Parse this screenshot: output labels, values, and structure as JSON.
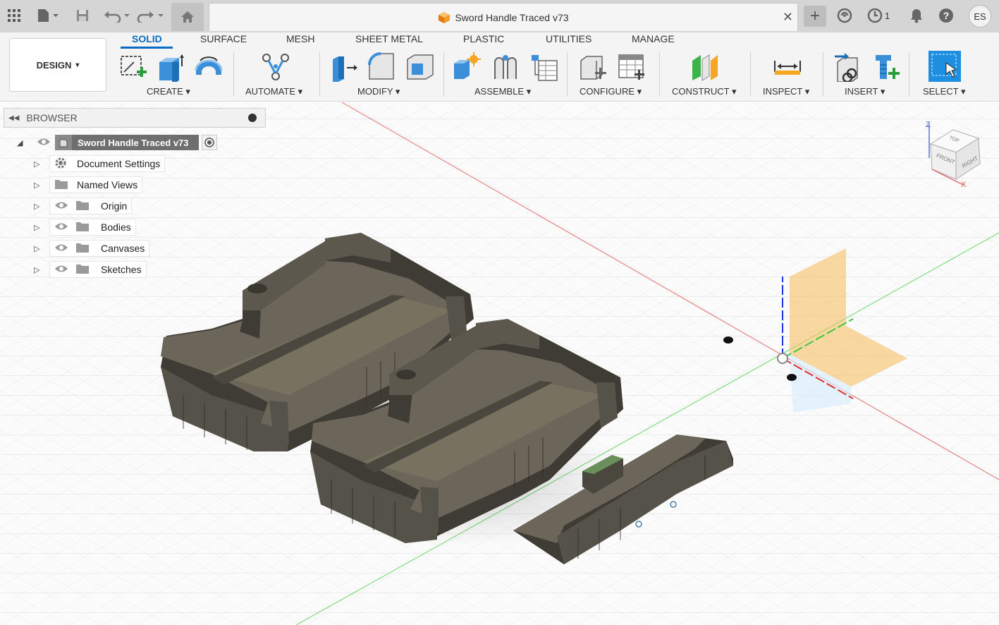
{
  "window": {
    "document_title": "Sword Handle Traced v73",
    "job_count": "1",
    "user_initials": "ES",
    "close_glyph": "✕",
    "plus_glyph": "+"
  },
  "workspace": {
    "label": "DESIGN",
    "caret": "▾"
  },
  "tabs": [
    {
      "label": "SOLID",
      "active": true
    },
    {
      "label": "SURFACE"
    },
    {
      "label": "MESH"
    },
    {
      "label": "SHEET METAL"
    },
    {
      "label": "PLASTIC"
    },
    {
      "label": "UTILITIES"
    },
    {
      "label": "MANAGE"
    }
  ],
  "groups": [
    {
      "label": "CREATE ▾"
    },
    {
      "label": "AUTOMATE ▾"
    },
    {
      "label": "MODIFY ▾"
    },
    {
      "label": "ASSEMBLE ▾"
    },
    {
      "label": "CONFIGURE ▾"
    },
    {
      "label": "CONSTRUCT ▾"
    },
    {
      "label": "INSPECT ▾"
    },
    {
      "label": "INSERT ▾"
    },
    {
      "label": "SELECT ▾"
    }
  ],
  "browser": {
    "title": "BROWSER",
    "root": "Sword Handle Traced v73",
    "items": [
      {
        "label": "Document Settings"
      },
      {
        "label": "Named Views"
      },
      {
        "label": "Origin"
      },
      {
        "label": "Bodies"
      },
      {
        "label": "Canvases"
      },
      {
        "label": "Sketches"
      }
    ]
  },
  "viewcube": {
    "top": "TOP",
    "front": "FRONT",
    "right": "RIGHT",
    "axis_z": "Z",
    "axis_x": "X"
  },
  "colors": {
    "accent": "#0a6cc4",
    "body_fill": "#6b6659",
    "body_dark": "#3f3c35",
    "axis_red": "#e05050",
    "axis_green": "#3cc83c",
    "axis_blue": "#2233dd",
    "plane_orange": "#f7b955"
  }
}
